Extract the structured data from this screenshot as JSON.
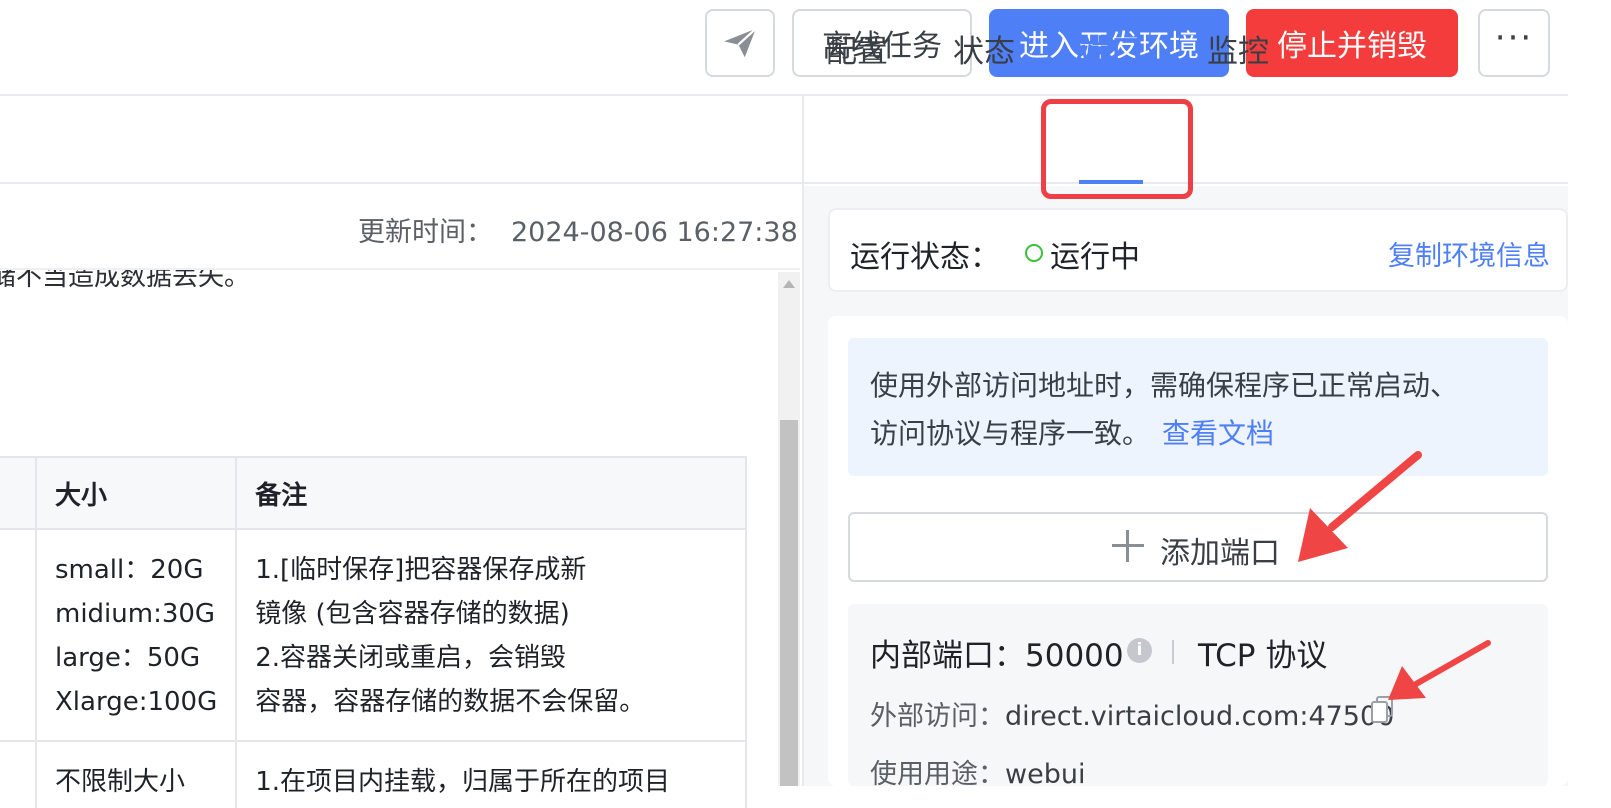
{
  "toolbar": {
    "send_icon": "paper-plane-icon",
    "offline_tasks": "离线任务",
    "enter_dev_env": "进入开发环境",
    "stop_destroy": "停止并销毁",
    "more": "···",
    "colors": {
      "primary": "#4f7ff7",
      "danger": "#f53c3c"
    }
  },
  "left": {
    "update_time_label": "更新时间：",
    "update_time_value": "2024-08-06 16:27:38",
    "cut_text": "储不当造成数据丢失。",
    "table": {
      "headers": [
        "",
        "大小",
        "备注"
      ],
      "rows": [
        {
          "c0": "",
          "c1": [
            "small：20G",
            "midium:30G",
            "large：50G",
            "Xlarge:100G"
          ],
          "c2": [
            "1.[临时保存]把容器保存成新",
            "镜像 (包含容器存储的数据)",
            "2.容器关闭或重启，会销毁",
            "容器，容器存储的数据不会保留。"
          ]
        },
        {
          "c0": "",
          "c1": [
            "不限制大小"
          ],
          "c2": [
            "1.在项目内挂载，归属于所在的项目"
          ]
        }
      ]
    }
  },
  "right": {
    "tabs": [
      "配置",
      "状态",
      "端口",
      "监控"
    ],
    "active_tab": "端口",
    "status_label": "运行状态：",
    "status_value": "运行中",
    "status_color": "#39c239",
    "copy_env_info": "复制环境信息",
    "notice_line1": "使用外部访问地址时，需确保程序已正常启动、",
    "notice_line2": "访问协议与程序一致。",
    "notice_link": "查看文档",
    "add_port": "添加端口",
    "port": {
      "internal_label": "内部端口：",
      "internal_value": "50000",
      "protocol": "TCP 协议",
      "external_label": "外部访问：",
      "external_value": "direct.virtaicloud.com:47500",
      "usage_label": "使用用途：",
      "usage_value": "webui"
    }
  },
  "annotations": {
    "highlight_color": "#ef3f46"
  }
}
